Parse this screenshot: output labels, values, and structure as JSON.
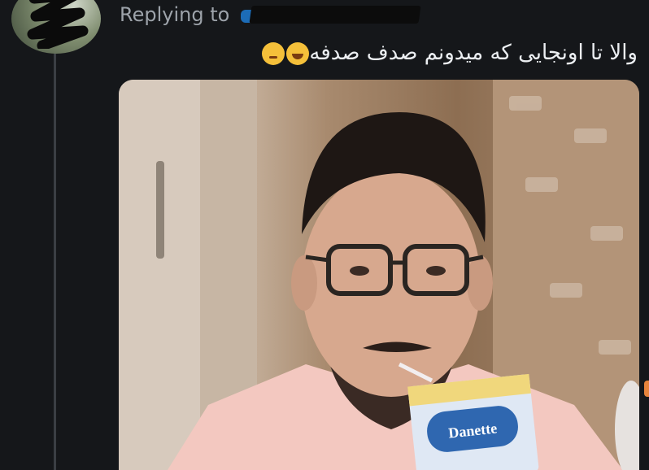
{
  "reply": {
    "prefix": "Replying to",
    "handle_redacted": true
  },
  "tweet": {
    "text": "والا تا اونجایی که میدونم صدف صدفه",
    "emojis": [
      "face-with-tears-of-joy",
      "pensive-face"
    ]
  },
  "media": {
    "carton_brand": "Danette"
  },
  "colors": {
    "background": "#15171a",
    "muted_text": "#9da3aa",
    "body_text": "#eceff2",
    "link_blue": "#1d7bd3"
  }
}
